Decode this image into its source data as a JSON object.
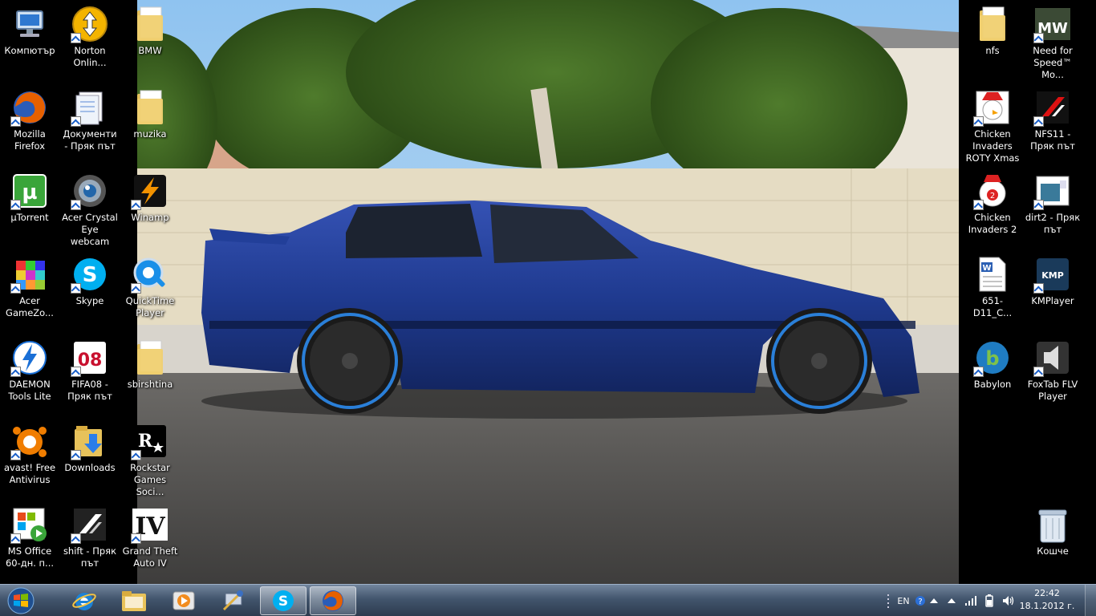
{
  "desktop": {
    "icons": [
      {
        "id": "computer",
        "label": "Компютър"
      },
      {
        "id": "norton",
        "label": "Norton Onlin..."
      },
      {
        "id": "bmw",
        "label": "BMW"
      },
      {
        "id": "firefox",
        "label": "Mozilla Firefox"
      },
      {
        "id": "documents",
        "label": "Документи - Пряк път"
      },
      {
        "id": "muzika",
        "label": "muzika"
      },
      {
        "id": "utorrent",
        "label": "µTorrent"
      },
      {
        "id": "webcam",
        "label": "Acer Crystal Eye webcam"
      },
      {
        "id": "winamp",
        "label": "Winamp"
      },
      {
        "id": "gamezone",
        "label": "Acer GameZo..."
      },
      {
        "id": "skype",
        "label": "Skype"
      },
      {
        "id": "quicktime",
        "label": "QuickTime Player"
      },
      {
        "id": "daemon",
        "label": "DAEMON Tools Lite"
      },
      {
        "id": "fifa08",
        "label": "FIFA08 - Пряк път"
      },
      {
        "id": "sbirshtina",
        "label": "sbirshtina"
      },
      {
        "id": "avast",
        "label": "avast! Free Antivirus"
      },
      {
        "id": "downloads",
        "label": "Downloads"
      },
      {
        "id": "rockstar",
        "label": "Rockstar Games Soci..."
      },
      {
        "id": "msoffice",
        "label": "MS Office 60-дн. п..."
      },
      {
        "id": "shift",
        "label": "shift - Пряк път"
      },
      {
        "id": "gta4",
        "label": "Grand Theft Auto IV"
      },
      {
        "id": "nfs",
        "label": "nfs"
      },
      {
        "id": "nfsmw",
        "label": "Need for Speed™ Mo..."
      },
      {
        "id": "chicken_xmas",
        "label": "Chicken Invaders ROTY Xmas"
      },
      {
        "id": "nfs11",
        "label": "NFS11 - Пряк път"
      },
      {
        "id": "chicken2",
        "label": "Chicken Invaders 2"
      },
      {
        "id": "dirt2",
        "label": "dirt2 - Пряк път"
      },
      {
        "id": "doc651",
        "label": "651-D11_C..."
      },
      {
        "id": "kmplayer",
        "label": "KMPlayer"
      },
      {
        "id": "babylon",
        "label": "Babylon"
      },
      {
        "id": "foxtab",
        "label": "FoxTab FLV Player"
      },
      {
        "id": "recycle",
        "label": "Кошче"
      }
    ]
  },
  "taskbar": {
    "pinned": [
      "Internet Explorer",
      "Windows Explorer",
      "Media Player",
      "Network Tool",
      "Skype",
      "Firefox"
    ],
    "tray": {
      "language": "EN",
      "time": "22:42",
      "date": "18.1.2012 г."
    }
  },
  "colors": {
    "taskbar": "#4a5d75",
    "car": "#1f3a8f"
  }
}
